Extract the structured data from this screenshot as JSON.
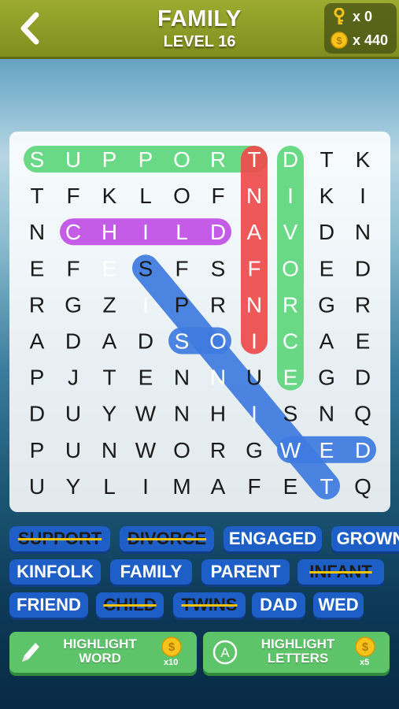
{
  "header": {
    "title": "FAMILY",
    "subtitle": "LEVEL 16",
    "keys": "x 0",
    "coins": "x 440"
  },
  "grid": [
    [
      "S",
      "U",
      "P",
      "P",
      "O",
      "R",
      "T",
      "D",
      "T",
      "K"
    ],
    [
      "T",
      "F",
      "K",
      "L",
      "O",
      "F",
      "N",
      "I",
      "K",
      "I"
    ],
    [
      "N",
      "C",
      "H",
      "I",
      "L",
      "D",
      "A",
      "V",
      "D",
      "N"
    ],
    [
      "E",
      "F",
      "E",
      "S",
      "F",
      "S",
      "F",
      "O",
      "E",
      "D"
    ],
    [
      "R",
      "G",
      "Z",
      "I",
      "P",
      "R",
      "N",
      "R",
      "G",
      "R"
    ],
    [
      "A",
      "D",
      "A",
      "D",
      "S",
      "O",
      "I",
      "C",
      "A",
      "E"
    ],
    [
      "P",
      "J",
      "T",
      "E",
      "N",
      "N",
      "U",
      "E",
      "G",
      "D"
    ],
    [
      "D",
      "U",
      "Y",
      "W",
      "N",
      "H",
      "I",
      "S",
      "N",
      "Q"
    ],
    [
      "P",
      "U",
      "N",
      "W",
      "O",
      "R",
      "G",
      "W",
      "E",
      "D"
    ],
    [
      "U",
      "Y",
      "L",
      "I",
      "M",
      "A",
      "F",
      "E",
      "T",
      "Q"
    ]
  ],
  "found_highlights": [
    {
      "word": "SUPPORT",
      "color": "#5fd77d",
      "from": [
        0,
        0
      ],
      "to": [
        0,
        6
      ]
    },
    {
      "word": "INFANT",
      "color": "#ef4b4b",
      "from": [
        5,
        6
      ],
      "to": [
        0,
        6
      ]
    },
    {
      "word": "DIVORCE",
      "color": "#5fd77d",
      "from": [
        0,
        7
      ],
      "to": [
        6,
        7
      ]
    },
    {
      "word": "CHILD",
      "color": "#c24fe6",
      "from": [
        2,
        1
      ],
      "to": [
        2,
        5
      ]
    },
    {
      "word": "TWINS",
      "color": "#3f7be0",
      "from": [
        9,
        8
      ],
      "to": [
        3,
        3
      ]
    },
    {
      "word": "WED",
      "color": "#3f7be0",
      "from": [
        8,
        7
      ],
      "to": [
        8,
        9
      ]
    },
    {
      "word": "SO",
      "color": "#3f7be0",
      "from": [
        5,
        4
      ],
      "to": [
        5,
        5
      ]
    }
  ],
  "words": [
    {
      "label": "SUPPORT",
      "found": true
    },
    {
      "label": "DIVORCE",
      "found": true
    },
    {
      "label": "ENGAGED",
      "found": false
    },
    {
      "label": "GROWN",
      "found": false
    },
    {
      "label": "KINFOLK",
      "found": false
    },
    {
      "label": "FAMILY",
      "found": false
    },
    {
      "label": "PARENT",
      "found": false
    },
    {
      "label": "INFANT",
      "found": true
    },
    {
      "label": "FRIEND",
      "found": false
    },
    {
      "label": "CHILD",
      "found": true
    },
    {
      "label": "TWINS",
      "found": true
    },
    {
      "label": "DAD",
      "found": false
    },
    {
      "label": "WED",
      "found": false
    }
  ],
  "buttons": {
    "highlight_word": {
      "label": "HIGHLIGHT WORD",
      "cost": "x10"
    },
    "highlight_letters": {
      "label": "HIGHLIGHT LETTERS",
      "cost": "x5"
    }
  },
  "colors": {
    "accent_green": "#5ec46a",
    "chip_blue": "#1d5fc7",
    "topbar": "#8e9d27"
  }
}
